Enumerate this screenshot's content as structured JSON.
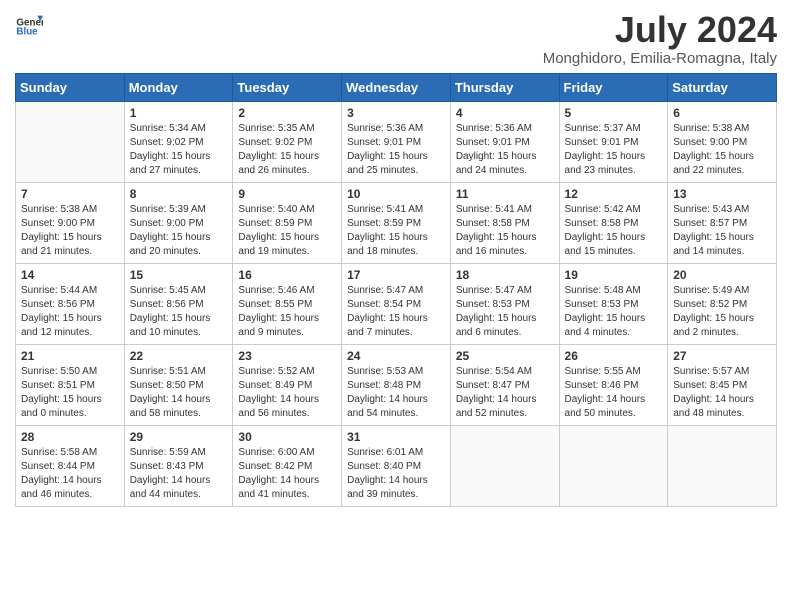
{
  "header": {
    "logo_line1": "General",
    "logo_line2": "Blue",
    "title": "July 2024",
    "subtitle": "Monghidoro, Emilia-Romagna, Italy"
  },
  "weekdays": [
    "Sunday",
    "Monday",
    "Tuesday",
    "Wednesday",
    "Thursday",
    "Friday",
    "Saturday"
  ],
  "weeks": [
    [
      {
        "day": "",
        "info": ""
      },
      {
        "day": "1",
        "info": "Sunrise: 5:34 AM\nSunset: 9:02 PM\nDaylight: 15 hours\nand 27 minutes."
      },
      {
        "day": "2",
        "info": "Sunrise: 5:35 AM\nSunset: 9:02 PM\nDaylight: 15 hours\nand 26 minutes."
      },
      {
        "day": "3",
        "info": "Sunrise: 5:36 AM\nSunset: 9:01 PM\nDaylight: 15 hours\nand 25 minutes."
      },
      {
        "day": "4",
        "info": "Sunrise: 5:36 AM\nSunset: 9:01 PM\nDaylight: 15 hours\nand 24 minutes."
      },
      {
        "day": "5",
        "info": "Sunrise: 5:37 AM\nSunset: 9:01 PM\nDaylight: 15 hours\nand 23 minutes."
      },
      {
        "day": "6",
        "info": "Sunrise: 5:38 AM\nSunset: 9:00 PM\nDaylight: 15 hours\nand 22 minutes."
      }
    ],
    [
      {
        "day": "7",
        "info": "Sunrise: 5:38 AM\nSunset: 9:00 PM\nDaylight: 15 hours\nand 21 minutes."
      },
      {
        "day": "8",
        "info": "Sunrise: 5:39 AM\nSunset: 9:00 PM\nDaylight: 15 hours\nand 20 minutes."
      },
      {
        "day": "9",
        "info": "Sunrise: 5:40 AM\nSunset: 8:59 PM\nDaylight: 15 hours\nand 19 minutes."
      },
      {
        "day": "10",
        "info": "Sunrise: 5:41 AM\nSunset: 8:59 PM\nDaylight: 15 hours\nand 18 minutes."
      },
      {
        "day": "11",
        "info": "Sunrise: 5:41 AM\nSunset: 8:58 PM\nDaylight: 15 hours\nand 16 minutes."
      },
      {
        "day": "12",
        "info": "Sunrise: 5:42 AM\nSunset: 8:58 PM\nDaylight: 15 hours\nand 15 minutes."
      },
      {
        "day": "13",
        "info": "Sunrise: 5:43 AM\nSunset: 8:57 PM\nDaylight: 15 hours\nand 14 minutes."
      }
    ],
    [
      {
        "day": "14",
        "info": "Sunrise: 5:44 AM\nSunset: 8:56 PM\nDaylight: 15 hours\nand 12 minutes."
      },
      {
        "day": "15",
        "info": "Sunrise: 5:45 AM\nSunset: 8:56 PM\nDaylight: 15 hours\nand 10 minutes."
      },
      {
        "day": "16",
        "info": "Sunrise: 5:46 AM\nSunset: 8:55 PM\nDaylight: 15 hours\nand 9 minutes."
      },
      {
        "day": "17",
        "info": "Sunrise: 5:47 AM\nSunset: 8:54 PM\nDaylight: 15 hours\nand 7 minutes."
      },
      {
        "day": "18",
        "info": "Sunrise: 5:47 AM\nSunset: 8:53 PM\nDaylight: 15 hours\nand 6 minutes."
      },
      {
        "day": "19",
        "info": "Sunrise: 5:48 AM\nSunset: 8:53 PM\nDaylight: 15 hours\nand 4 minutes."
      },
      {
        "day": "20",
        "info": "Sunrise: 5:49 AM\nSunset: 8:52 PM\nDaylight: 15 hours\nand 2 minutes."
      }
    ],
    [
      {
        "day": "21",
        "info": "Sunrise: 5:50 AM\nSunset: 8:51 PM\nDaylight: 15 hours\nand 0 minutes."
      },
      {
        "day": "22",
        "info": "Sunrise: 5:51 AM\nSunset: 8:50 PM\nDaylight: 14 hours\nand 58 minutes."
      },
      {
        "day": "23",
        "info": "Sunrise: 5:52 AM\nSunset: 8:49 PM\nDaylight: 14 hours\nand 56 minutes."
      },
      {
        "day": "24",
        "info": "Sunrise: 5:53 AM\nSunset: 8:48 PM\nDaylight: 14 hours\nand 54 minutes."
      },
      {
        "day": "25",
        "info": "Sunrise: 5:54 AM\nSunset: 8:47 PM\nDaylight: 14 hours\nand 52 minutes."
      },
      {
        "day": "26",
        "info": "Sunrise: 5:55 AM\nSunset: 8:46 PM\nDaylight: 14 hours\nand 50 minutes."
      },
      {
        "day": "27",
        "info": "Sunrise: 5:57 AM\nSunset: 8:45 PM\nDaylight: 14 hours\nand 48 minutes."
      }
    ],
    [
      {
        "day": "28",
        "info": "Sunrise: 5:58 AM\nSunset: 8:44 PM\nDaylight: 14 hours\nand 46 minutes."
      },
      {
        "day": "29",
        "info": "Sunrise: 5:59 AM\nSunset: 8:43 PM\nDaylight: 14 hours\nand 44 minutes."
      },
      {
        "day": "30",
        "info": "Sunrise: 6:00 AM\nSunset: 8:42 PM\nDaylight: 14 hours\nand 41 minutes."
      },
      {
        "day": "31",
        "info": "Sunrise: 6:01 AM\nSunset: 8:40 PM\nDaylight: 14 hours\nand 39 minutes."
      },
      {
        "day": "",
        "info": ""
      },
      {
        "day": "",
        "info": ""
      },
      {
        "day": "",
        "info": ""
      }
    ]
  ]
}
